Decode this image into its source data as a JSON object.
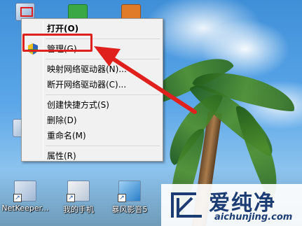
{
  "context_menu": {
    "items": [
      {
        "label": "打开(O)",
        "bold": true
      },
      {
        "label": "管理(G)",
        "icon": "shield-icon"
      },
      {
        "label": "映射网络驱动器(N)..."
      },
      {
        "label": "断开网络驱动器(C)..."
      },
      {
        "label": "创建快捷方式(S)"
      },
      {
        "label": "删除(D)"
      },
      {
        "label": "重命名(M)"
      },
      {
        "label": "属性(R)"
      }
    ]
  },
  "desktop_icons": [
    {
      "label": "NetKeeper..."
    },
    {
      "label": "我的手机"
    },
    {
      "label": "暴风影音5"
    }
  ],
  "watermark": {
    "title": "爱纯净",
    "url": "aichunjing.com"
  },
  "colors": {
    "annotation_red": "#e0201d",
    "menu_background": "#f1f1f1"
  }
}
